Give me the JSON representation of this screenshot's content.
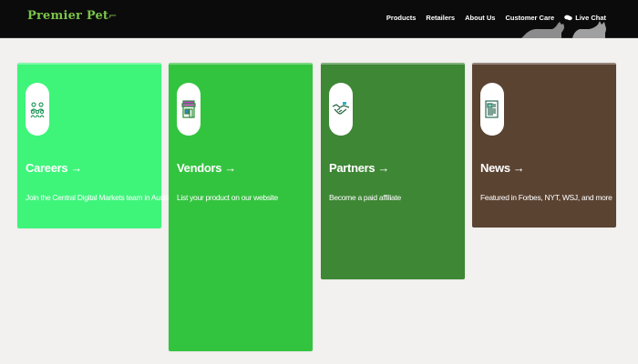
{
  "header": {
    "logo_text": "Premier Pet",
    "nav": [
      {
        "label": "Products"
      },
      {
        "label": "Retailers"
      },
      {
        "label": "About Us"
      },
      {
        "label": "Customer Care"
      },
      {
        "label": "Live Chat",
        "icon": "chat-bubbles-icon"
      }
    ]
  },
  "cards": [
    {
      "title": "Careers",
      "arrow": "→",
      "description": "Join the Central Digital Markets team in Austin",
      "icon": "people-group-icon",
      "color": "#3ef57a"
    },
    {
      "title": "Vendors",
      "arrow": "→",
      "description": "List your product on our website",
      "icon": "storefront-icon",
      "color": "#33c43f"
    },
    {
      "title": "Partners",
      "arrow": "→",
      "description": "Become a paid affiliate",
      "icon": "handshake-icon",
      "color": "#3e8735"
    },
    {
      "title": "News",
      "arrow": "→",
      "description": "Featured in Forbes, NYT, WSJ, and more",
      "icon": "newspaper-icon",
      "color": "#5b4332"
    }
  ]
}
